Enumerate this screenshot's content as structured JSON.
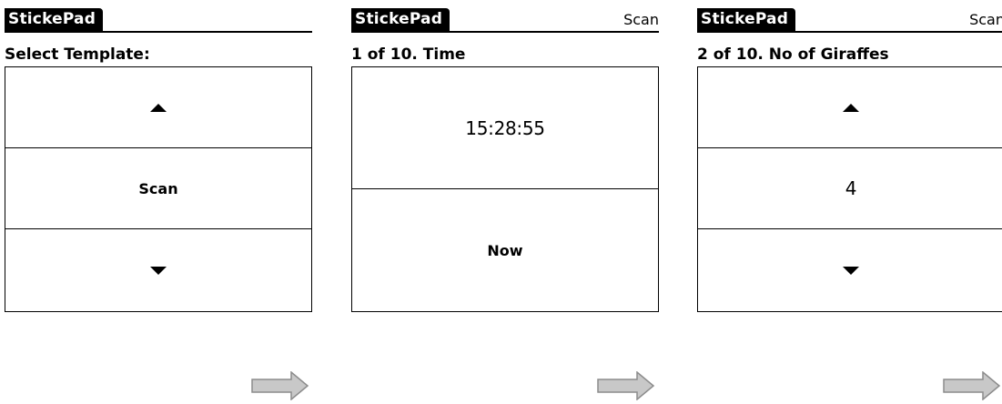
{
  "screens": [
    {
      "app_title": "StickePad",
      "header_action": "",
      "subtitle": "Select Template:",
      "up_icon": "up-triangle-icon",
      "center_label": "Scan",
      "down_icon": "down-triangle-icon"
    },
    {
      "app_title": "StickePad",
      "header_action": "Scan",
      "subtitle": "1 of 10. Time",
      "value": "15:28:55",
      "action_label": "Now"
    },
    {
      "app_title": "StickePad",
      "header_action": "Scan",
      "subtitle": "2 of 10. No of Giraffes",
      "up_icon": "up-triangle-icon",
      "value": "4",
      "down_icon": "down-triangle-icon"
    }
  ],
  "arrows": [
    {
      "icon": "right-arrow-icon"
    },
    {
      "icon": "right-arrow-icon"
    },
    {
      "icon": "right-arrow-icon"
    }
  ],
  "colors": {
    "title_bg": "#000000",
    "title_text": "#ffffff",
    "arrow_fill": "#c8c8c8",
    "arrow_stroke": "#8c8c8c"
  }
}
